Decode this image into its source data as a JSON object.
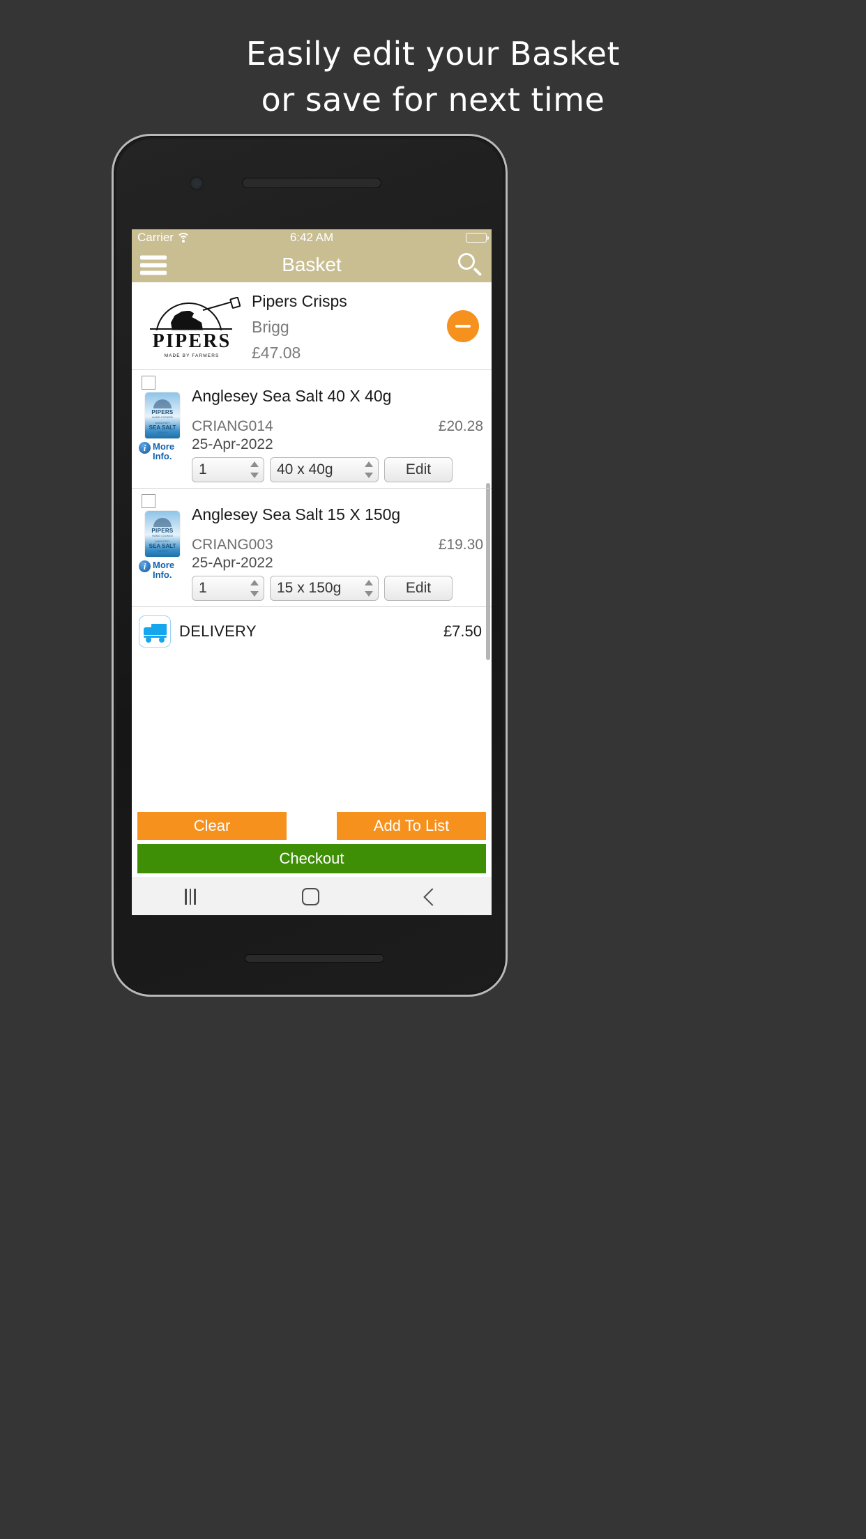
{
  "promo": {
    "line1": "Easily edit your Basket",
    "line2": "or save for next time"
  },
  "status_bar": {
    "carrier": "Carrier",
    "wifi_icon": "wifi-icon",
    "time": "6:42 AM",
    "battery_icon": "battery-icon"
  },
  "nav_bar": {
    "menu_icon": "hamburger-menu-icon",
    "title": "Basket",
    "search_icon": "search-icon",
    "background": "#c9bd92"
  },
  "vendor": {
    "logo_word": "PIPERS",
    "logo_tagline": "MADE BY FARMERS",
    "name": "Pipers Crisps",
    "location": "Brigg",
    "total": "£47.08",
    "remove_label": "remove-vendor",
    "remove_color": "#f6911e"
  },
  "products": [
    {
      "checkbox_checked": false,
      "name": "Anglesey Sea Salt 40 X 40g",
      "code": "CRIANG014",
      "date": "25-Apr-2022",
      "price": "£20.28",
      "qty": "1",
      "size": "40 x 40g",
      "edit_label": "Edit",
      "more_info_line1": "More",
      "more_info_line2": "Info.",
      "pack_brand": "PIPERS",
      "pack_flavour": "SEA SALT",
      "pack_sub1": "HAND COOKED",
      "pack_sub2": "ANGLESEY",
      "pack_sub3": "CRISPS"
    },
    {
      "checkbox_checked": false,
      "name": "Anglesey Sea Salt 15 X 150g",
      "code": "CRIANG003",
      "date": "25-Apr-2022",
      "price": "£19.30",
      "qty": "1",
      "size": "15 x 150g",
      "edit_label": "Edit",
      "more_info_line1": "More",
      "more_info_line2": "Info.",
      "pack_brand": "PIPERS",
      "pack_flavour": "SEA SALT",
      "pack_sub1": "HAND COOKED",
      "pack_sub2": "ANGLESEY",
      "pack_sub3": "CRISPS"
    }
  ],
  "delivery": {
    "icon": "delivery-truck-icon",
    "label": "DELIVERY",
    "price": "£7.50",
    "icon_color": "#16a6ee"
  },
  "actions": {
    "clear_label": "Clear",
    "add_to_list_label": "Add To List",
    "checkout_label": "Checkout",
    "orange": "#f6911e",
    "green": "#3f8f06"
  },
  "android_nav": {
    "recents_icon": "recents-icon",
    "home_icon": "home-icon",
    "back_icon": "back-icon"
  }
}
